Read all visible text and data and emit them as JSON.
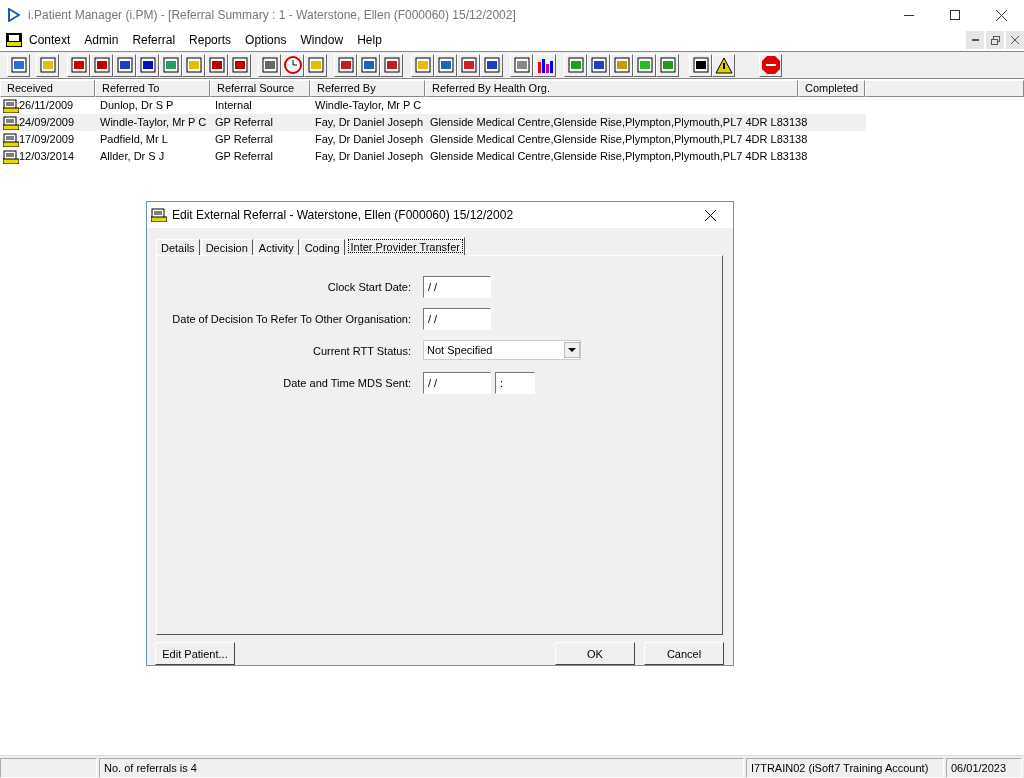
{
  "window": {
    "title": "i.Patient Manager (i.PM) - [Referral Summary : 1 - Waterstone, Ellen (F000060) 15/12/2002]"
  },
  "menu": [
    "Context",
    "Admin",
    "Referral",
    "Reports",
    "Options",
    "Window",
    "Help"
  ],
  "table": {
    "columns": [
      "Received",
      "Referred To",
      "Referral Source",
      "Referred By",
      "Referred By Health Org.",
      "Completed"
    ],
    "rows": [
      {
        "selected": false,
        "cells": [
          "26/11/2009",
          "Dunlop, Dr S P",
          "Internal",
          "Windle-Taylor, Mr P C",
          ""
        ]
      },
      {
        "selected": true,
        "cells": [
          "24/09/2009",
          "Windle-Taylor, Mr P C",
          "GP Referral",
          "Fay, Dr Daniel Joseph",
          "Glenside Medical Centre,Glenside Rise,Plympton,Plymouth,PL7 4DR L83138"
        ]
      },
      {
        "selected": false,
        "cells": [
          "17/09/2009",
          "Padfield, Mr L",
          "GP Referral",
          "Fay, Dr Daniel Joseph",
          "Glenside Medical Centre,Glenside Rise,Plympton,Plymouth,PL7 4DR L83138"
        ]
      },
      {
        "selected": false,
        "cells": [
          "12/03/2014",
          "Allder, Dr S J",
          "GP Referral",
          "Fay, Dr Daniel Joseph",
          "Glenside Medical Centre,Glenside Rise,Plympton,Plymouth,PL7 4DR L83138"
        ]
      }
    ]
  },
  "dialog": {
    "title": "Edit External Referral - Waterstone, Ellen (F000060) 15/12/2002",
    "tabs": [
      {
        "label": "Details",
        "selected": false
      },
      {
        "label": "Decision",
        "selected": false
      },
      {
        "label": "Activity",
        "selected": false
      },
      {
        "label": "Coding",
        "selected": false
      },
      {
        "label": "Inter Provider Transfer",
        "selected": true
      }
    ],
    "fields": [
      {
        "kind": "date",
        "label": "Clock Start Date:",
        "value": "/ /"
      },
      {
        "kind": "date",
        "label": "Date of Decision To Refer To Other Organisation:",
        "value": "/ /"
      },
      {
        "kind": "select",
        "label": "Current RTT Status:",
        "value": "Not Specified"
      },
      {
        "kind": "datetime",
        "label": "Date  and Time MDS Sent:",
        "value": "/ /",
        "time": ":"
      }
    ],
    "buttons": {
      "left": "Edit Patient...",
      "ok": "OK",
      "cancel": "Cancel"
    }
  },
  "status_bar": {
    "message": "No. of referrals is 4",
    "account": "I7TRAIN02 (iSoft7 Training Account)",
    "date": "06/01/2023"
  }
}
